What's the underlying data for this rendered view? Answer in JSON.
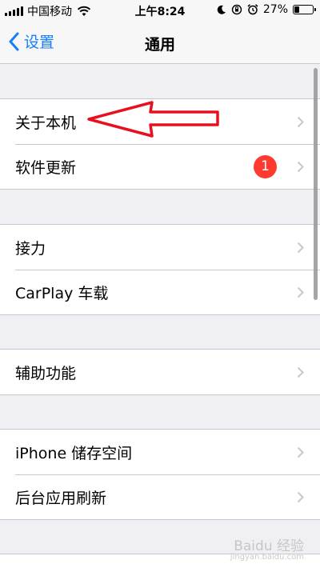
{
  "status_bar": {
    "carrier": "中国移动",
    "time": "上午8:24",
    "battery_percent": "27%",
    "battery_level": 0.27,
    "icons": [
      "signal-icon",
      "wifi-icon",
      "moon-icon",
      "orientation-lock-icon",
      "alarm-icon",
      "battery-icon"
    ]
  },
  "nav": {
    "back_label": "设置",
    "title": "通用"
  },
  "groups": [
    {
      "items": [
        {
          "label": "关于本机"
        },
        {
          "label": "软件更新",
          "badge": "1"
        }
      ]
    },
    {
      "items": [
        {
          "label": "接力"
        },
        {
          "label": "CarPlay 车载"
        }
      ]
    },
    {
      "items": [
        {
          "label": "辅助功能"
        }
      ]
    },
    {
      "items": [
        {
          "label": "iPhone 储存空间"
        },
        {
          "label": "后台应用刷新"
        }
      ]
    }
  ],
  "colors": {
    "accent": "#157efb",
    "badge": "#ff3b30",
    "annotation": "#e8101f",
    "background": "#efeff4"
  },
  "watermark": {
    "text": "Baidu 经验",
    "sub": "jingyan.baidu.com"
  }
}
